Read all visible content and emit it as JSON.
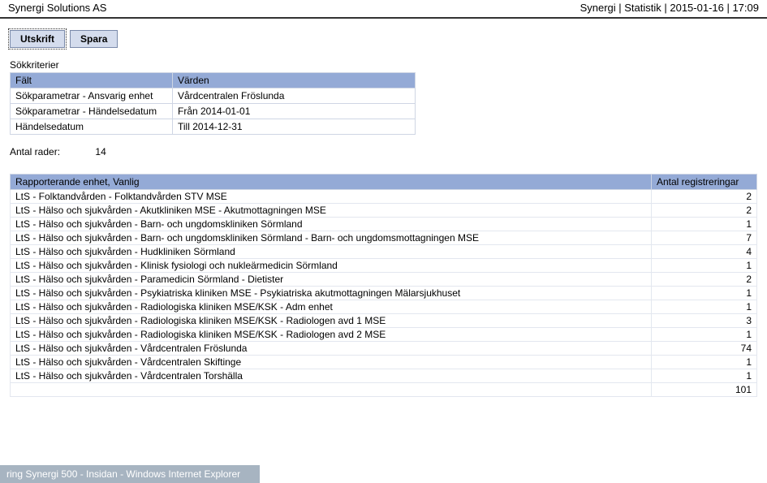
{
  "header": {
    "company": "Synergi Solutions AS",
    "right": "Synergi | Statistik | 2015-01-16 | 17:09"
  },
  "toolbar": {
    "print_label": "Utskrift",
    "save_label": "Spara"
  },
  "criteria": {
    "label": "Sökkriterier",
    "headers": {
      "field": "Fält",
      "values": "Värden"
    },
    "rows": [
      {
        "field": "Sökparametrar - Ansvarig enhet",
        "value": "Vårdcentralen Fröslunda"
      },
      {
        "field": "Sökparametrar - Händelsedatum",
        "value": "Från 2014-01-01"
      },
      {
        "field": "Händelsedatum",
        "value": "Till 2014-12-31"
      }
    ]
  },
  "rowcount": {
    "label": "Antal rader:",
    "value": "14"
  },
  "results": {
    "headers": {
      "unit": "Rapporterande enhet, Vanlig",
      "count": "Antal registreringar"
    },
    "rows": [
      {
        "unit": "LtS - Folktandvården - Folktandvården STV MSE",
        "count": "2"
      },
      {
        "unit": "LtS - Hälso och sjukvården - Akutkliniken MSE - Akutmottagningen MSE",
        "count": "2"
      },
      {
        "unit": "LtS - Hälso och sjukvården - Barn- och ungdomskliniken Sörmland",
        "count": "1"
      },
      {
        "unit": "LtS - Hälso och sjukvården - Barn- och ungdomskliniken Sörmland - Barn- och ungdomsmottagningen MSE",
        "count": "7"
      },
      {
        "unit": "LtS - Hälso och sjukvården - Hudkliniken Sörmland",
        "count": "4"
      },
      {
        "unit": "LtS - Hälso och sjukvården - Klinisk fysiologi och nukleärmedicin Sörmland",
        "count": "1"
      },
      {
        "unit": "LtS - Hälso och sjukvården - Paramedicin Sörmland - Dietister",
        "count": "2"
      },
      {
        "unit": "LtS - Hälso och sjukvården - Psykiatriska kliniken MSE - Psykiatriska akutmottagningen Mälarsjukhuset",
        "count": "1"
      },
      {
        "unit": "LtS - Hälso och sjukvården - Radiologiska kliniken MSE/KSK - Adm enhet",
        "count": "1"
      },
      {
        "unit": "LtS - Hälso och sjukvården - Radiologiska kliniken MSE/KSK - Radiologen avd 1 MSE",
        "count": "3"
      },
      {
        "unit": "LtS - Hälso och sjukvården - Radiologiska kliniken MSE/KSK - Radiologen avd 2 MSE",
        "count": "1"
      },
      {
        "unit": "LtS - Hälso och sjukvården - Vårdcentralen Fröslunda",
        "count": "74"
      },
      {
        "unit": "LtS - Hälso och sjukvården - Vårdcentralen Skiftinge",
        "count": "1"
      },
      {
        "unit": "LtS - Hälso och sjukvården - Vårdcentralen Torshälla",
        "count": "1"
      }
    ],
    "total": "101"
  },
  "taskbar_ghost": "ring Synergi 500 - Insidan - Windows Internet Explorer"
}
